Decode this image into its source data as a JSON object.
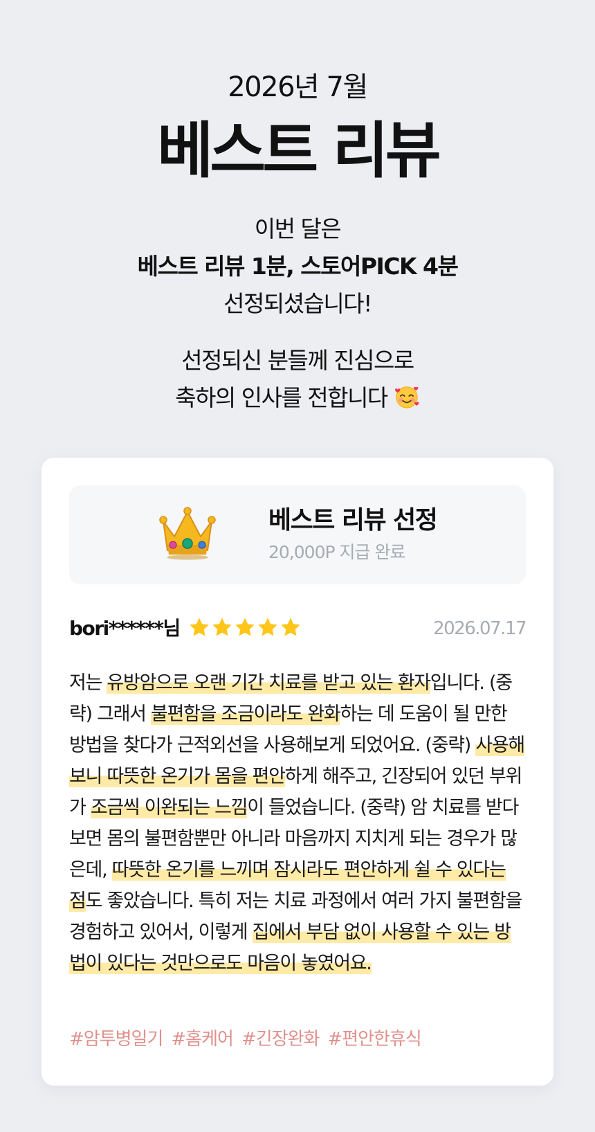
{
  "header": {
    "month": "2026년 7월",
    "title": "베스트 리뷰",
    "intro_line1": "이번 달은",
    "intro_line2": "베스트 리뷰 1분, 스토어PICK 4분",
    "intro_line3": "선정되셨습니다!",
    "congrats_line1": "선정되신 분들께 진심으로",
    "congrats_line2": "축하의 인사를 전합니다",
    "emoji": "smiling-face-with-hearts-icon"
  },
  "badge": {
    "icon": "crown-icon",
    "title": "베스트 리뷰 선정",
    "subtitle": "20,000P 지급 완료"
  },
  "review": {
    "user": "bori******님",
    "rating": 5,
    "date": "2026.07.17",
    "segments": [
      {
        "text": "저는 ",
        "hl": false
      },
      {
        "text": "유방암으로 오랜 기간 치료를 받고 있는 환자",
        "hl": true
      },
      {
        "text": "입니다. (중략) 그래서 ",
        "hl": false
      },
      {
        "text": "불편함을 조금이라도 완화",
        "hl": true
      },
      {
        "text": "하는 데 도움이 될 만한 방법을 찾다가 근적외선을 사용해보게 되었어요. (중략) ",
        "hl": false
      },
      {
        "text": "사용해보니 따뜻한 온기가 몸을 편안",
        "hl": true
      },
      {
        "text": "하게 해주고, 긴장되어 있던 부위가 ",
        "hl": false
      },
      {
        "text": "조금씩 이완되는 느낌",
        "hl": true
      },
      {
        "text": "이 들었습니다. (중략) 암 치료를 받다 보면 몸의 불편함뿐만 아니라 마음까지 지치게 되는 경우가 많은데, ",
        "hl": false
      },
      {
        "text": "따뜻한 온기를 느끼며 잠시라도 편안하게 쉴 수 있다는 점",
        "hl": true
      },
      {
        "text": "도 좋았습니다. 특히 저는 치료 과정에서 여러 가지 불편함을 경험하고 있어서, 이렇게 ",
        "hl": false
      },
      {
        "text": "집에서 부담 없이 사용할 수 있는 방법이 있다는 것만으로도 마음이 놓였어요.",
        "hl": true
      }
    ],
    "tags": [
      "#암투병일기",
      "#홈케어",
      "#긴장완화",
      "#편안한휴식"
    ]
  },
  "colors": {
    "background": "#eceef2",
    "highlight": "#ffeaa6",
    "star": "#ffc619",
    "tag": "#e0908c",
    "muted": "#a6abb3"
  }
}
